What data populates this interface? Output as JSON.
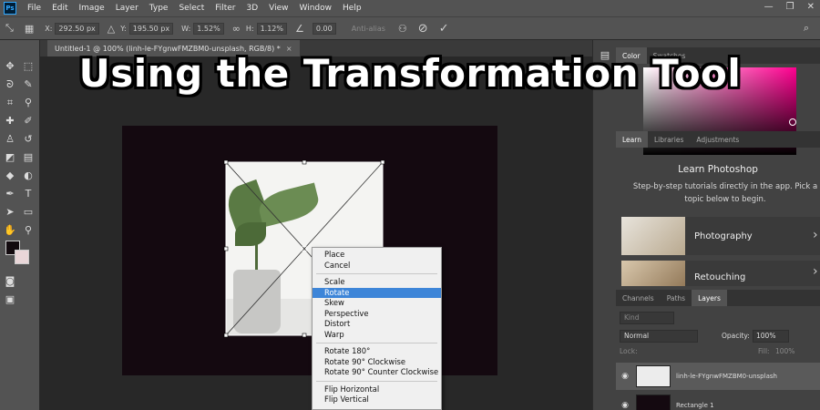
{
  "app": {
    "logo_text": "Ps",
    "menu": [
      "File",
      "Edit",
      "Image",
      "Layer",
      "Type",
      "Select",
      "Filter",
      "3D",
      "View",
      "Window",
      "Help"
    ],
    "window_controls": {
      "minimize": "—",
      "restore": "❐",
      "close": "✕"
    }
  },
  "options_bar": {
    "x_label": "X:",
    "x_value": "292.50 px",
    "y_label": "Y:",
    "y_value": "195.50 px",
    "w_label": "W:",
    "w_value": "1.52%",
    "h_label": "H:",
    "h_value": "1.12%",
    "angle_value": "0.00",
    "interp_label": "Anti-alias",
    "cancel_icon": "⊘",
    "commit_icon": "✓"
  },
  "document": {
    "tab_title": "Untitled-1 @ 100% (linh-le-FYgnwFMZBM0-unsplash, RGB/8) *",
    "tab_close": "×"
  },
  "context_menu": {
    "groups": [
      [
        "Place",
        "Cancel"
      ],
      [
        "Scale",
        "Rotate",
        "Skew",
        "Perspective",
        "Distort",
        "Warp"
      ],
      [
        "Rotate 180°",
        "Rotate 90° Clockwise",
        "Rotate 90° Counter Clockwise"
      ],
      [
        "Flip Horizontal",
        "Flip Vertical"
      ]
    ],
    "highlighted": "Rotate"
  },
  "color_panel": {
    "tabs": [
      "Color",
      "Swatches"
    ]
  },
  "learn_panel": {
    "tabs": [
      "Learn",
      "Libraries",
      "Adjustments"
    ],
    "title": "Learn Photoshop",
    "desc_line1": "Step-by-step tutorials directly in the app. Pick a",
    "desc_line2": "topic below to begin.",
    "cards": [
      "Photography",
      "Retouching"
    ]
  },
  "layers_panel": {
    "tabs": [
      "Channels",
      "Paths",
      "Layers"
    ],
    "search_placeholder": "Kind",
    "blend_mode": "Normal",
    "opacity_label": "Opacity:",
    "opacity_value": "100%",
    "lock_label": "Lock:",
    "fill_label": "Fill:",
    "fill_value": "100%",
    "layers": [
      "linh-le-FYgnwFMZBM0-unsplash",
      "Rectangle 1"
    ]
  },
  "overlay_title": "Using the Transformation Tool"
}
